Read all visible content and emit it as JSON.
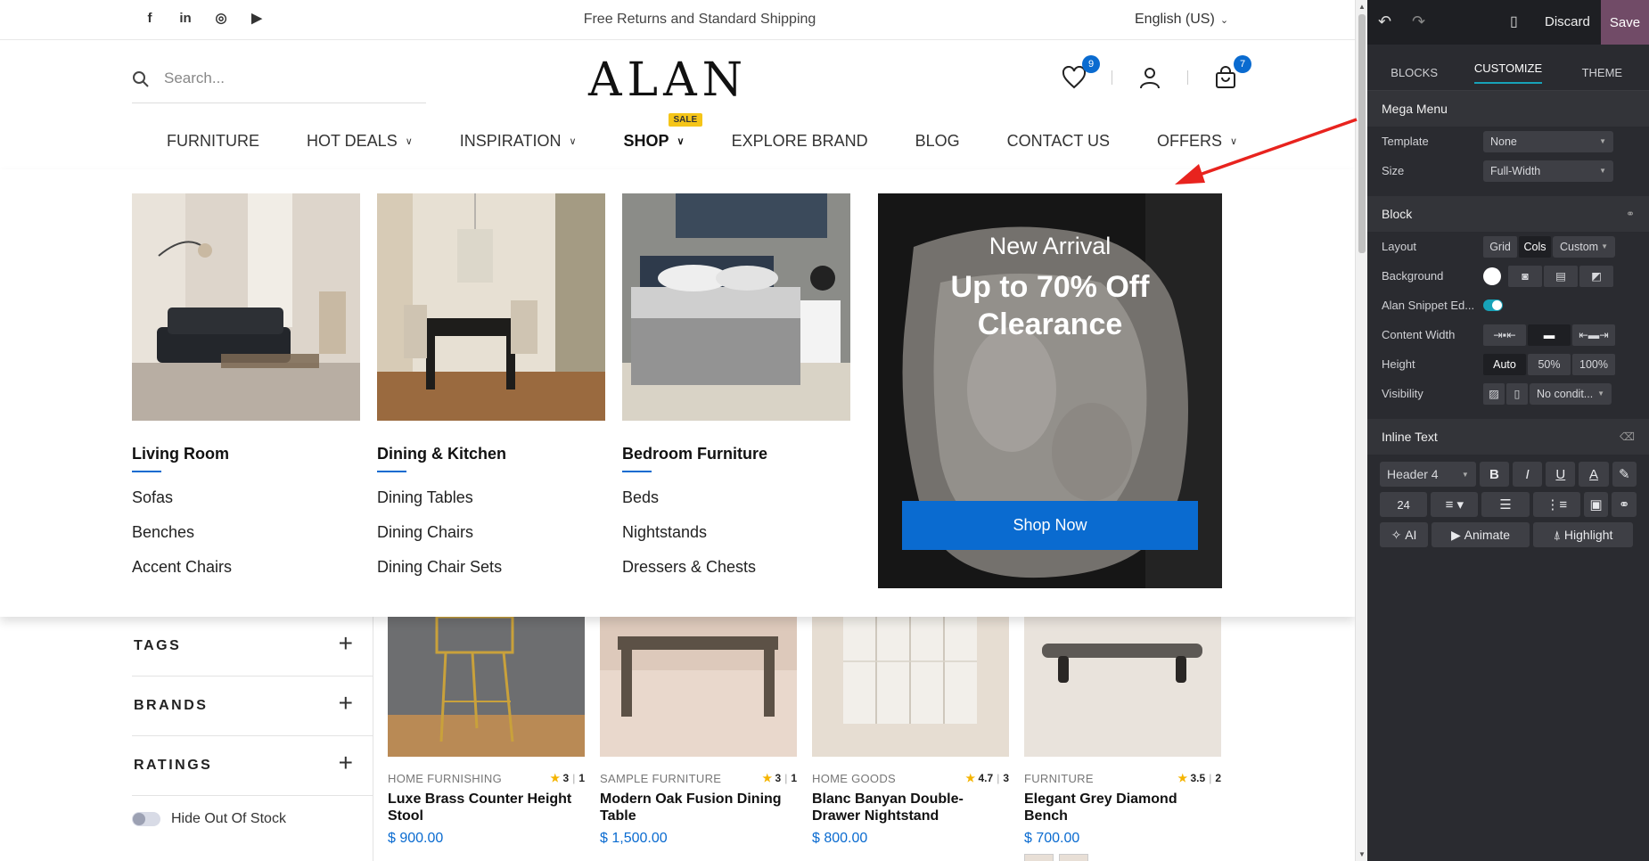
{
  "topbar": {
    "social": [
      "f",
      "in",
      "◎",
      "▶"
    ],
    "promo": "Free Returns and Standard Shipping",
    "language": "English (US)"
  },
  "header": {
    "search_placeholder": "Search...",
    "logo": "ALAN",
    "wishlist_count": "9",
    "cart_count": "7"
  },
  "nav": {
    "items": [
      {
        "label": "FURNITURE"
      },
      {
        "label": "HOT DEALS"
      },
      {
        "label": "INSPIRATION"
      },
      {
        "label": "SHOP"
      },
      {
        "label": "EXPLORE BRAND"
      },
      {
        "label": "BLOG"
      },
      {
        "label": "CONTACT US"
      },
      {
        "label": "OFFERS"
      }
    ],
    "sale_badge": "SALE"
  },
  "mega_menu": {
    "columns": [
      {
        "title": "Living Room",
        "links": [
          "Sofas",
          "Benches",
          "Accent Chairs"
        ]
      },
      {
        "title": "Dining & Kitchen",
        "links": [
          "Dining Tables",
          "Dining Chairs",
          "Dining Chair Sets"
        ]
      },
      {
        "title": "Bedroom Furniture",
        "links": [
          "Beds",
          "Nightstands",
          "Dressers & Chests"
        ]
      }
    ],
    "banner": {
      "line1": "New Arrival",
      "line2": "Up to 70% Off",
      "line3": "Clearance",
      "button": "Shop Now"
    }
  },
  "filters": {
    "groups": [
      "TAGS",
      "BRANDS",
      "RATINGS"
    ],
    "hide_out_of_stock": "Hide Out Of Stock"
  },
  "products": [
    {
      "category": "HOME FURNISHING",
      "rating": "3",
      "reviews": "1",
      "name": "Luxe Brass Counter Height Stool",
      "price": "$ 900.00"
    },
    {
      "category": "SAMPLE FURNITURE",
      "rating": "3",
      "reviews": "1",
      "name": "Modern Oak Fusion Dining Table",
      "price": "$ 1,500.00"
    },
    {
      "category": "HOME GOODS",
      "rating": "4.7",
      "reviews": "3",
      "name": "Blanc Banyan Double-Drawer Nightstand",
      "price": "$ 800.00"
    },
    {
      "category": "FURNITURE",
      "rating": "3.5",
      "reviews": "2",
      "name": "Elegant Grey Diamond Bench",
      "price": "$ 700.00"
    }
  ],
  "editor": {
    "top": {
      "discard": "Discard",
      "save": "Save"
    },
    "tabs": [
      "BLOCKS",
      "CUSTOMIZE",
      "THEME"
    ],
    "mega_menu_section": {
      "title": "Mega Menu",
      "template_label": "Template",
      "template_value": "None",
      "size_label": "Size",
      "size_value": "Full-Width"
    },
    "block_section": {
      "title": "Block",
      "layout_label": "Layout",
      "layout_opts": [
        "Grid",
        "Cols",
        "Custom"
      ],
      "background_label": "Background",
      "snippet_label": "Alan Snippet Ed...",
      "content_width_label": "Content Width",
      "height_label": "Height",
      "height_opts": [
        "Auto",
        "50%",
        "100%"
      ],
      "visibility_label": "Visibility",
      "visibility_value": "No condit..."
    },
    "inline_text_section": {
      "title": "Inline Text",
      "style_value": "Header 4",
      "font_size": "24",
      "ai_label": "AI",
      "animate_label": "Animate",
      "highlight_label": "Highlight"
    }
  },
  "colors": {
    "accent_blue": "#0a6bd0",
    "sale_yellow": "#f5c518",
    "save_purple": "#714b67",
    "arrow_red": "#e8231e"
  }
}
